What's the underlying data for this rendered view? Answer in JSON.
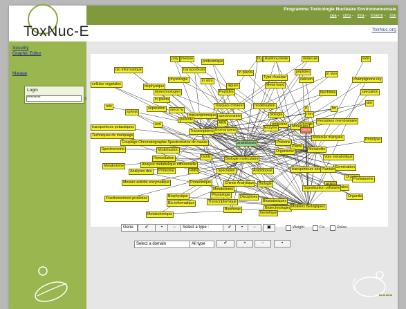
{
  "header": {
    "program_title": "Programme Toxicologie Nucléaire Environnementale",
    "links": [
      "cea",
      "cnrs",
      "inra",
      "inserm",
      "irsn"
    ],
    "site_link": "ToxNuc.org",
    "logo": "ToxNuc-E"
  },
  "sidebar": {
    "items": [
      {
        "label": "Security"
      },
      {
        "label": "Graphic Editor"
      },
      {
        "label": "Malage"
      }
    ],
    "login_label": "Login",
    "password_value": "**********",
    "go_label": "Go"
  },
  "graph": {
    "nodes": [
      "poly",
      "meiose",
      "proteomique",
      "In",
      "Radionucléide",
      "Radionucleide",
      "molecule",
      "iode",
      "bio informatique",
      "transporteurs",
      "in planta",
      "peptides",
      "in vivo",
      "physiologie",
      "in vitro",
      "Type d'ueuser",
      "calcium",
      "champignons rey",
      "cellules vegetales",
      "biophysique",
      "biotechnologies",
      "Peptides",
      "algues",
      "Metal lourd",
      "biochimie",
      "specialion",
      "in planta",
      "Toxiques d'interet",
      "modélisation",
      "Ir",
      "abc",
      "rein",
      "sphndt",
      "separation",
      "serce?a",
      "transcriptomique",
      "spectrometrie",
      "biologie",
      "rmn",
      "for",
      "aouris",
      "tellurite",
      "ARN",
      "proteome",
      "Gluside",
      "Recepteur membranaire",
      "transporteurs potassiques",
      "wrd",
      "Transcriptome",
      "Biomarqueur",
      "Enzyme",
      "Molecules",
      "Gene",
      "Techniques de marquage",
      "Molecule marquee",
      "Protolyse",
      "Couplage Chromatographie Spectrometrie de masse",
      "Proteine",
      "Plante",
      "Metabolite",
      "Voie metabolique",
      "Spectrometrie",
      "Modelisation",
      "arabidopsis",
      "Organisme",
      "Remediation",
      "Outils",
      "Biologie moleculaire",
      "Analyse metabolique differentielle",
      "Germination",
      "Metabolome",
      "Analyses des",
      "Proteome",
      "RMN",
      "Speciation",
      "Arabidopsis",
      "transporteurs abc",
      "Plantule",
      "Organe",
      "Mesure activite enzymatique",
      "Proteomique",
      "Chimie Analytique",
      "Biologie",
      "axiant",
      "Proteasome",
      "les vegetales",
      "Metabolome",
      "Signalisation cellulaire",
      "Fractionnement proteines",
      "Biophysique",
      "Physiologie",
      "Disciplines",
      "Biostatistiques",
      "Organite",
      "Bio informatique",
      "Transcriptomique",
      "Biotechnologies",
      "Modeles Biologiques",
      "Metabolomique",
      "Biochimie",
      "Genetique"
    ]
  },
  "toolbar": {
    "gene_input_value": "Gene",
    "select_type_label": "Select a type :",
    "check_icon": "check",
    "plus_icon": "plus",
    "minus_icon": "minus",
    "dot_icon": "dot",
    "save_icon": "save",
    "checkboxes": [
      "Weight",
      "Fix",
      "Relax"
    ],
    "domain_select": "Select a domain",
    "type_select": "All type"
  },
  "colors": {
    "sidebar": "#99b64f",
    "header_band": "#7e9a3c",
    "node_fill": "#f2ef2a",
    "node_highlight": "#8fd28a",
    "node_gene": "#e66a6a"
  }
}
